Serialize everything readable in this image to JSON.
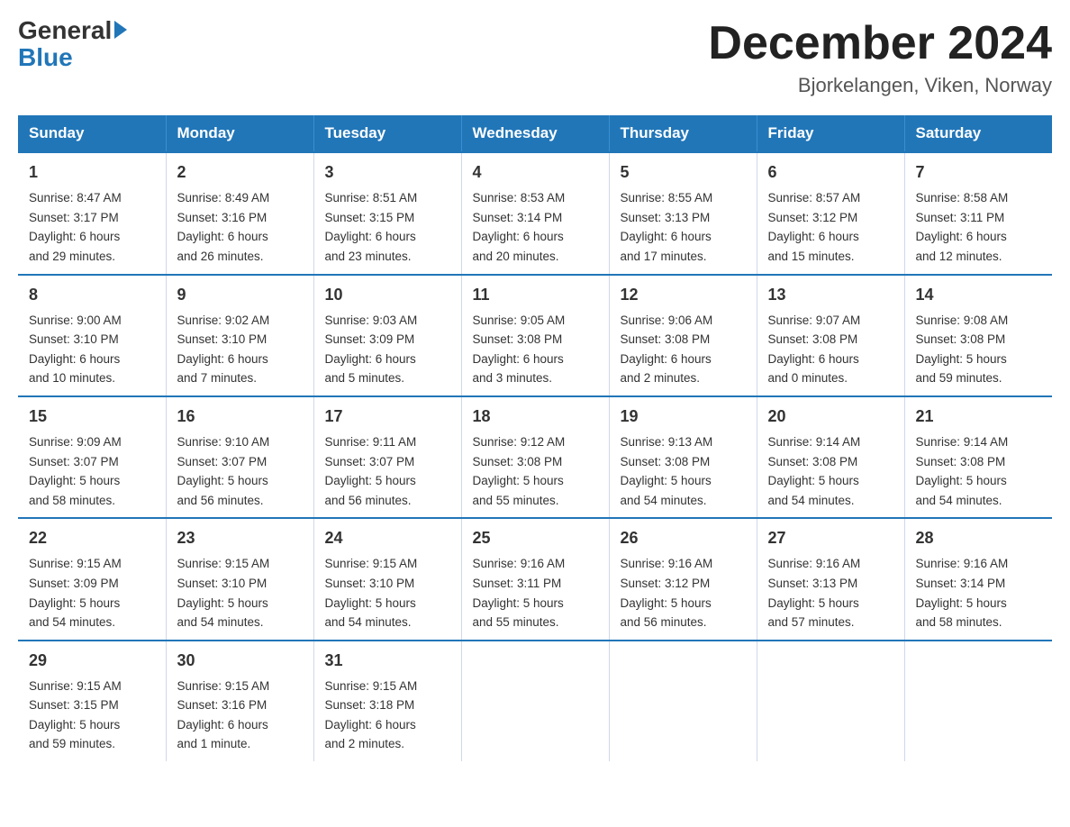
{
  "logo": {
    "general": "General",
    "blue": "Blue"
  },
  "title": "December 2024",
  "location": "Bjorkelangen, Viken, Norway",
  "days_of_week": [
    "Sunday",
    "Monday",
    "Tuesday",
    "Wednesday",
    "Thursday",
    "Friday",
    "Saturday"
  ],
  "weeks": [
    [
      {
        "day": "1",
        "info": "Sunrise: 8:47 AM\nSunset: 3:17 PM\nDaylight: 6 hours\nand 29 minutes."
      },
      {
        "day": "2",
        "info": "Sunrise: 8:49 AM\nSunset: 3:16 PM\nDaylight: 6 hours\nand 26 minutes."
      },
      {
        "day": "3",
        "info": "Sunrise: 8:51 AM\nSunset: 3:15 PM\nDaylight: 6 hours\nand 23 minutes."
      },
      {
        "day": "4",
        "info": "Sunrise: 8:53 AM\nSunset: 3:14 PM\nDaylight: 6 hours\nand 20 minutes."
      },
      {
        "day": "5",
        "info": "Sunrise: 8:55 AM\nSunset: 3:13 PM\nDaylight: 6 hours\nand 17 minutes."
      },
      {
        "day": "6",
        "info": "Sunrise: 8:57 AM\nSunset: 3:12 PM\nDaylight: 6 hours\nand 15 minutes."
      },
      {
        "day": "7",
        "info": "Sunrise: 8:58 AM\nSunset: 3:11 PM\nDaylight: 6 hours\nand 12 minutes."
      }
    ],
    [
      {
        "day": "8",
        "info": "Sunrise: 9:00 AM\nSunset: 3:10 PM\nDaylight: 6 hours\nand 10 minutes."
      },
      {
        "day": "9",
        "info": "Sunrise: 9:02 AM\nSunset: 3:10 PM\nDaylight: 6 hours\nand 7 minutes."
      },
      {
        "day": "10",
        "info": "Sunrise: 9:03 AM\nSunset: 3:09 PM\nDaylight: 6 hours\nand 5 minutes."
      },
      {
        "day": "11",
        "info": "Sunrise: 9:05 AM\nSunset: 3:08 PM\nDaylight: 6 hours\nand 3 minutes."
      },
      {
        "day": "12",
        "info": "Sunrise: 9:06 AM\nSunset: 3:08 PM\nDaylight: 6 hours\nand 2 minutes."
      },
      {
        "day": "13",
        "info": "Sunrise: 9:07 AM\nSunset: 3:08 PM\nDaylight: 6 hours\nand 0 minutes."
      },
      {
        "day": "14",
        "info": "Sunrise: 9:08 AM\nSunset: 3:08 PM\nDaylight: 5 hours\nand 59 minutes."
      }
    ],
    [
      {
        "day": "15",
        "info": "Sunrise: 9:09 AM\nSunset: 3:07 PM\nDaylight: 5 hours\nand 58 minutes."
      },
      {
        "day": "16",
        "info": "Sunrise: 9:10 AM\nSunset: 3:07 PM\nDaylight: 5 hours\nand 56 minutes."
      },
      {
        "day": "17",
        "info": "Sunrise: 9:11 AM\nSunset: 3:07 PM\nDaylight: 5 hours\nand 56 minutes."
      },
      {
        "day": "18",
        "info": "Sunrise: 9:12 AM\nSunset: 3:08 PM\nDaylight: 5 hours\nand 55 minutes."
      },
      {
        "day": "19",
        "info": "Sunrise: 9:13 AM\nSunset: 3:08 PM\nDaylight: 5 hours\nand 54 minutes."
      },
      {
        "day": "20",
        "info": "Sunrise: 9:14 AM\nSunset: 3:08 PM\nDaylight: 5 hours\nand 54 minutes."
      },
      {
        "day": "21",
        "info": "Sunrise: 9:14 AM\nSunset: 3:08 PM\nDaylight: 5 hours\nand 54 minutes."
      }
    ],
    [
      {
        "day": "22",
        "info": "Sunrise: 9:15 AM\nSunset: 3:09 PM\nDaylight: 5 hours\nand 54 minutes."
      },
      {
        "day": "23",
        "info": "Sunrise: 9:15 AM\nSunset: 3:10 PM\nDaylight: 5 hours\nand 54 minutes."
      },
      {
        "day": "24",
        "info": "Sunrise: 9:15 AM\nSunset: 3:10 PM\nDaylight: 5 hours\nand 54 minutes."
      },
      {
        "day": "25",
        "info": "Sunrise: 9:16 AM\nSunset: 3:11 PM\nDaylight: 5 hours\nand 55 minutes."
      },
      {
        "day": "26",
        "info": "Sunrise: 9:16 AM\nSunset: 3:12 PM\nDaylight: 5 hours\nand 56 minutes."
      },
      {
        "day": "27",
        "info": "Sunrise: 9:16 AM\nSunset: 3:13 PM\nDaylight: 5 hours\nand 57 minutes."
      },
      {
        "day": "28",
        "info": "Sunrise: 9:16 AM\nSunset: 3:14 PM\nDaylight: 5 hours\nand 58 minutes."
      }
    ],
    [
      {
        "day": "29",
        "info": "Sunrise: 9:15 AM\nSunset: 3:15 PM\nDaylight: 5 hours\nand 59 minutes."
      },
      {
        "day": "30",
        "info": "Sunrise: 9:15 AM\nSunset: 3:16 PM\nDaylight: 6 hours\nand 1 minute."
      },
      {
        "day": "31",
        "info": "Sunrise: 9:15 AM\nSunset: 3:18 PM\nDaylight: 6 hours\nand 2 minutes."
      },
      null,
      null,
      null,
      null
    ]
  ]
}
